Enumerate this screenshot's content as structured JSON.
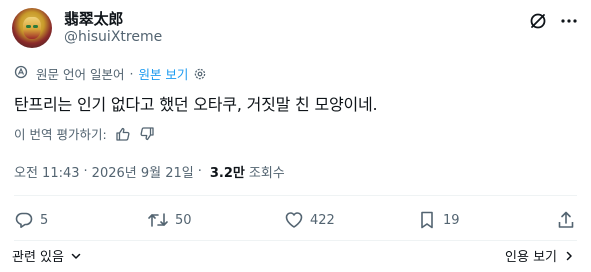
{
  "author": {
    "display_name": "翡翠太郎",
    "handle": "@hisuiXtreme"
  },
  "translation": {
    "notice": "원문 언어 일본어",
    "view_original": "원본 보기"
  },
  "tweet": {
    "text": "탄프리는 인기 없다고 했던 오타쿠, 거짓말 친 모양이네."
  },
  "rating": {
    "prompt": "이 번역 평가하기:"
  },
  "meta": {
    "time": "오전 11:43",
    "sep1": "·",
    "date": "2026년 9월 21일",
    "sep2": "·",
    "views": "3.2만",
    "views_label": "조회수"
  },
  "actions": {
    "replies": "5",
    "retweets": "50",
    "likes": "422",
    "bookmarks": "19"
  },
  "footer": {
    "related": "관련 있음",
    "view_quotes": "인용 보기"
  },
  "icons": [
    "grok-icon",
    "more-icon",
    "translate-icon",
    "settings-icon",
    "thumbs-up-icon",
    "thumbs-down-icon",
    "reply-icon",
    "retweet-icon",
    "like-icon",
    "bookmark-icon",
    "share-icon",
    "chevron-down-icon",
    "chevron-right-icon"
  ],
  "colors": {
    "accent": "#1d9bf0",
    "text": "#0f1419",
    "secondary": "#536471"
  }
}
